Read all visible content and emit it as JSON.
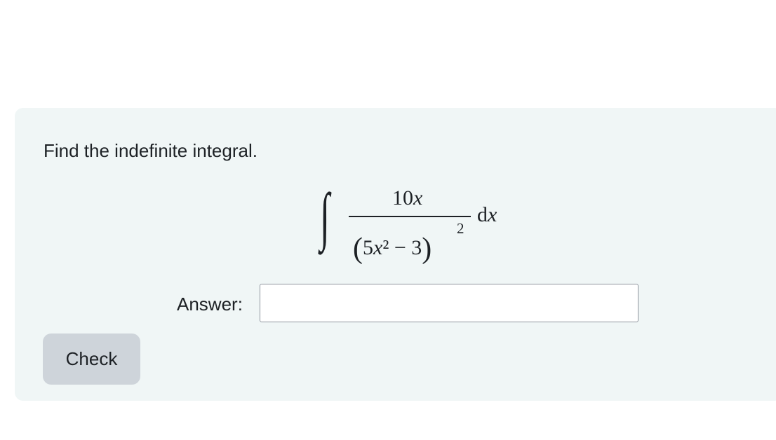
{
  "question": {
    "prompt": "Find the indefinite integral.",
    "math": {
      "integral_sign": "∫",
      "numerator": {
        "coefficient": "10",
        "variable": "x"
      },
      "denominator": {
        "open_paren": "(",
        "coefficient": "5",
        "variable": "x",
        "power": "²",
        "operator": "−",
        "constant": "3",
        "close_paren": ")"
      },
      "outer_exponent": "2",
      "differential": {
        "d": "d",
        "variable": "x"
      }
    }
  },
  "answer": {
    "label": "Answer:",
    "value": "",
    "placeholder": ""
  },
  "actions": {
    "check_label": "Check"
  },
  "colors": {
    "card_background": "#f0f6f6",
    "text": "#1d2125",
    "button_background": "#ced4da"
  }
}
